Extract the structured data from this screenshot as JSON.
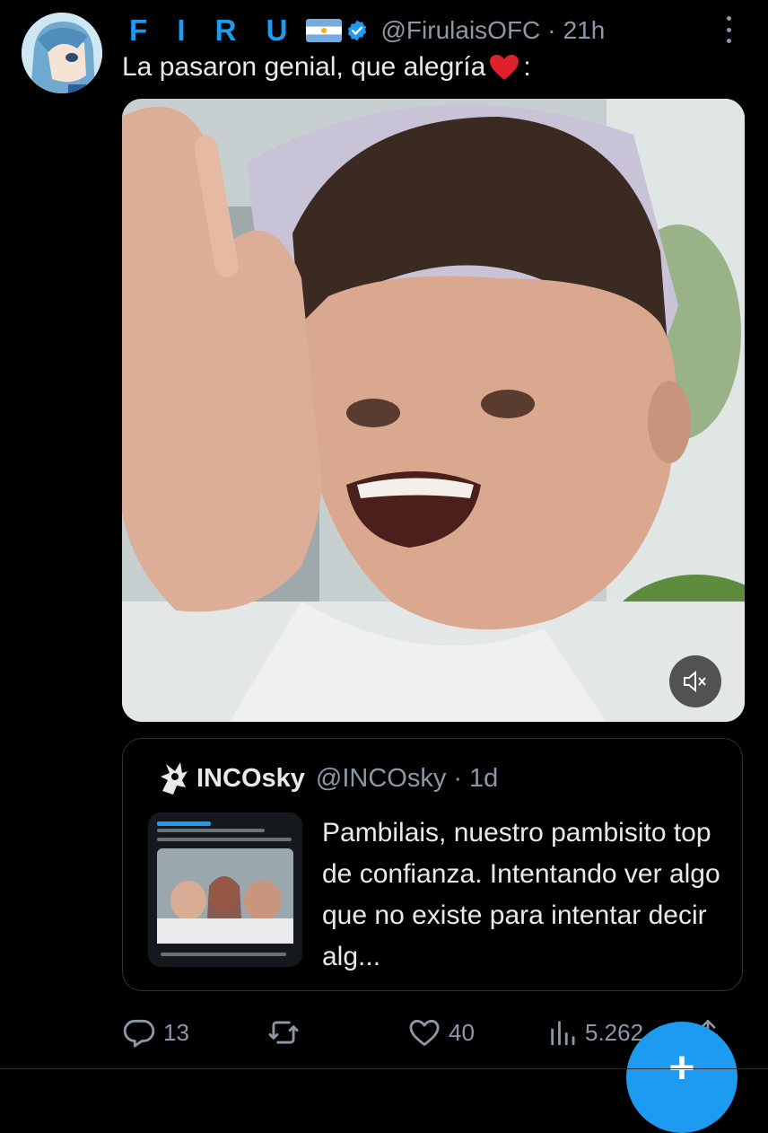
{
  "tweet": {
    "display_name": "F I R U",
    "handle": "@FirulaisOFC",
    "separator": "·",
    "time": "21h",
    "text": "La pasaron genial, que alegría",
    "text_suffix": ":"
  },
  "quoted_tweet": {
    "display_name": "INCOsky",
    "handle": "@INCOsky",
    "separator": "·",
    "time": "1d",
    "text": "Pambilais, nuestro pambisito top de confianza. Intentando ver algo que no existe para intentar decir alg..."
  },
  "actions": {
    "reply_count": "13",
    "retweet_count": "",
    "like_count": "40",
    "views_count": "5.262"
  },
  "fab": {
    "label": "+"
  },
  "colors": {
    "accent": "#1d9bf0",
    "text": "#e7e9ea",
    "muted": "#8b98a5",
    "border": "#2f3336",
    "background": "#000000"
  },
  "icons": [
    "avatar",
    "argentina-flag-emoji",
    "verified-badge-icon",
    "more-icon",
    "red-heart-emoji",
    "mute-icon",
    "incosky-logo",
    "reply-icon",
    "retweet-icon",
    "like-icon",
    "views-icon",
    "share-icon",
    "compose-plus-icon"
  ]
}
